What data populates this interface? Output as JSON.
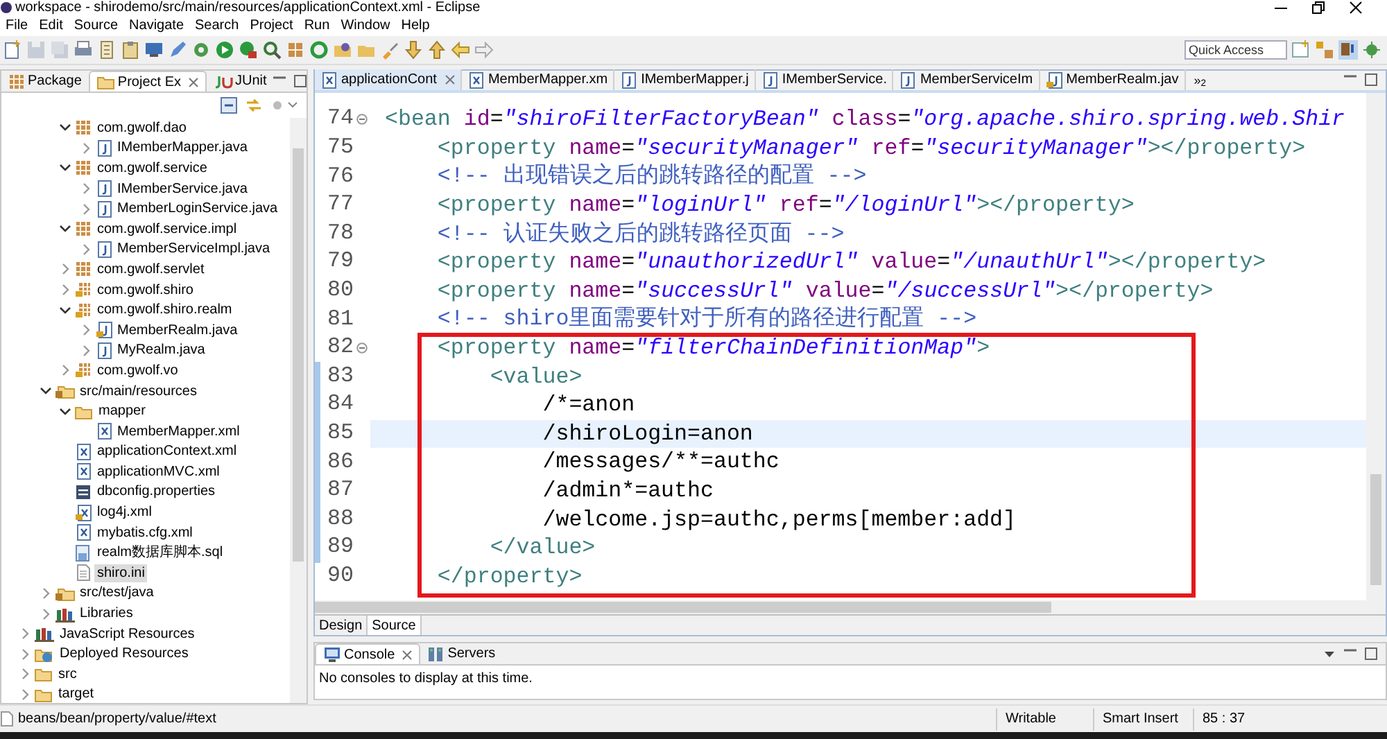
{
  "window": {
    "title": "workspace - shirodemo/src/main/resources/applicationContext.xml - Eclipse"
  },
  "menu": [
    "File",
    "Edit",
    "Source",
    "Navigate",
    "Search",
    "Project",
    "Run",
    "Window",
    "Help"
  ],
  "toolbar": {
    "quick_access": {
      "placeholder": "Quick Access"
    }
  },
  "left_view": {
    "tabs": [
      {
        "label": "Package",
        "kind": "package",
        "selected": false,
        "closable": false
      },
      {
        "label": "Project Ex",
        "kind": "folder",
        "selected": true,
        "closable": true
      },
      {
        "label": "JUnit",
        "kind": "junit",
        "selected": false,
        "closable": false
      }
    ],
    "tree": [
      {
        "children": [
          {
            "children": [
              {
                "label": "com.gwolf.dao",
                "kind": "package",
                "expanded": true,
                "selected": false,
                "children": [
                  {
                    "label": "IMemberMapper.java",
                    "kind": "java",
                    "expanded": false,
                    "selected": false
                  }
                ]
              },
              {
                "label": "com.gwolf.service",
                "kind": "package",
                "expanded": true,
                "selected": false,
                "children": [
                  {
                    "label": "IMemberService.java",
                    "kind": "java",
                    "expanded": false,
                    "selected": false
                  },
                  {
                    "label": "MemberLoginService.java",
                    "kind": "java",
                    "expanded": false,
                    "selected": false
                  }
                ]
              },
              {
                "label": "com.gwolf.service.impl",
                "kind": "package",
                "expanded": true,
                "selected": false,
                "children": [
                  {
                    "label": "MemberServiceImpl.java",
                    "kind": "java",
                    "expanded": false,
                    "selected": false
                  }
                ]
              },
              {
                "label": "com.gwolf.servlet",
                "kind": "package",
                "expanded": false,
                "selected": false
              },
              {
                "label": "com.gwolf.shiro",
                "kind": "package-locked",
                "expanded": false,
                "selected": false
              },
              {
                "label": "com.gwolf.shiro.realm",
                "kind": "package-locked",
                "expanded": true,
                "selected": false,
                "children": [
                  {
                    "label": "MemberRealm.java",
                    "kind": "java-locked",
                    "expanded": false,
                    "selected": false
                  },
                  {
                    "label": "MyRealm.java",
                    "kind": "java",
                    "expanded": false,
                    "selected": false
                  }
                ]
              },
              {
                "label": "com.gwolf.vo",
                "kind": "package-locked",
                "expanded": false,
                "selected": false
              }
            ]
          },
          {
            "label": "src/main/resources",
            "kind": "source-folder",
            "expanded": true,
            "selected": false,
            "children": [
              {
                "label": "mapper",
                "kind": "folder",
                "expanded": true,
                "selected": false,
                "children": [
                  {
                    "label": "MemberMapper.xml",
                    "kind": "xml",
                    "selected": false
                  }
                ]
              },
              {
                "label": "applicationContext.xml",
                "kind": "xml",
                "selected": false
              },
              {
                "label": "applicationMVC.xml",
                "kind": "xml",
                "selected": false
              },
              {
                "label": "dbconfig.properties",
                "kind": "properties",
                "selected": false
              },
              {
                "label": "log4j.xml",
                "kind": "xml-locked",
                "selected": false
              },
              {
                "label": "mybatis.cfg.xml",
                "kind": "xml",
                "selected": false
              },
              {
                "label": "realm数据库脚本.sql",
                "kind": "sql",
                "selected": false
              },
              {
                "label": "shiro.ini",
                "kind": "file",
                "selected": true
              }
            ]
          },
          {
            "label": "src/test/java",
            "kind": "source-folder",
            "expanded": false,
            "selected": false
          },
          {
            "label": "Libraries",
            "kind": "library",
            "expanded": false,
            "selected": false
          }
        ]
      },
      {
        "label": "JavaScript Resources",
        "kind": "library",
        "expanded": false,
        "selected": false
      },
      {
        "label": "Deployed Resources",
        "kind": "deployed",
        "expanded": false,
        "selected": false
      },
      {
        "label": "src",
        "kind": "folder",
        "expanded": false,
        "selected": false
      },
      {
        "label": "target",
        "kind": "folder",
        "expanded": false,
        "selected": false
      }
    ]
  },
  "editor": {
    "tabs": [
      {
        "label": "applicationCont",
        "kind": "xml",
        "selected": true,
        "closable": true
      },
      {
        "label": "MemberMapper.xm",
        "kind": "xml",
        "selected": false,
        "closable": false
      },
      {
        "label": "IMemberMapper.j",
        "kind": "java",
        "selected": false,
        "closable": false
      },
      {
        "label": "IMemberService.",
        "kind": "java",
        "selected": false,
        "closable": false
      },
      {
        "label": "MemberServiceIm",
        "kind": "java",
        "selected": false,
        "closable": false
      },
      {
        "label": "MemberRealm.jav",
        "kind": "java-locked",
        "selected": false,
        "closable": false
      }
    ],
    "overflow": "»$_{2}$",
    "lines": [
      {
        "number": "74",
        "foldable": true,
        "current": false,
        "changed": false,
        "tokens": [
          {
            "kind": "tag",
            "text": " <bean "
          },
          {
            "kind": "attr",
            "text": "id"
          },
          {
            "kind": "plain",
            "text": "="
          },
          {
            "kind": "value",
            "text": "\"shiroFilterFactoryBean\""
          },
          {
            "kind": "attr",
            "text": " class"
          },
          {
            "kind": "plain",
            "text": "="
          },
          {
            "kind": "value",
            "text": "\"org.apache.shiro.spring.web.Shir"
          }
        ]
      },
      {
        "number": "75",
        "foldable": false,
        "current": false,
        "changed": false,
        "tokens": [
          {
            "kind": "tag",
            "text": "     <property "
          },
          {
            "kind": "attr",
            "text": "name"
          },
          {
            "kind": "plain",
            "text": "="
          },
          {
            "kind": "value",
            "text": "\"securityManager\""
          },
          {
            "kind": "attr",
            "text": " ref"
          },
          {
            "kind": "plain",
            "text": "="
          },
          {
            "kind": "value",
            "text": "\"securityManager\""
          },
          {
            "kind": "tag",
            "text": "></property>"
          }
        ]
      },
      {
        "number": "76",
        "foldable": false,
        "current": false,
        "changed": false,
        "tokens": [
          {
            "kind": "comment",
            "text": "     <!-- 出现错误之后的跳转路径的配置 -->"
          }
        ]
      },
      {
        "number": "77",
        "foldable": false,
        "current": false,
        "changed": false,
        "tokens": [
          {
            "kind": "tag",
            "text": "     <property "
          },
          {
            "kind": "attr",
            "text": "name"
          },
          {
            "kind": "plain",
            "text": "="
          },
          {
            "kind": "value",
            "text": "\"loginUrl\""
          },
          {
            "kind": "attr",
            "text": " ref"
          },
          {
            "kind": "plain",
            "text": "="
          },
          {
            "kind": "value",
            "text": "\"/loginUrl\""
          },
          {
            "kind": "tag",
            "text": "></property>"
          }
        ]
      },
      {
        "number": "78",
        "foldable": false,
        "current": false,
        "changed": false,
        "tokens": [
          {
            "kind": "comment",
            "text": "     <!-- 认证失败之后的跳转路径页面 -->"
          }
        ]
      },
      {
        "number": "79",
        "foldable": false,
        "current": false,
        "changed": false,
        "tokens": [
          {
            "kind": "tag",
            "text": "     <property "
          },
          {
            "kind": "attr",
            "text": "name"
          },
          {
            "kind": "plain",
            "text": "="
          },
          {
            "kind": "value",
            "text": "\"unauthorizedUrl\""
          },
          {
            "kind": "attr",
            "text": " value"
          },
          {
            "kind": "plain",
            "text": "="
          },
          {
            "kind": "value",
            "text": "\"/unauthUrl\""
          },
          {
            "kind": "tag",
            "text": "></property>"
          }
        ]
      },
      {
        "number": "80",
        "foldable": false,
        "current": false,
        "changed": false,
        "tokens": [
          {
            "kind": "tag",
            "text": "     <property "
          },
          {
            "kind": "attr",
            "text": "name"
          },
          {
            "kind": "plain",
            "text": "="
          },
          {
            "kind": "value",
            "text": "\"successUrl\""
          },
          {
            "kind": "attr",
            "text": " value"
          },
          {
            "kind": "plain",
            "text": "="
          },
          {
            "kind": "value",
            "text": "\"/successUrl\""
          },
          {
            "kind": "tag",
            "text": "></property>"
          }
        ]
      },
      {
        "number": "81",
        "foldable": false,
        "current": false,
        "changed": false,
        "tokens": [
          {
            "kind": "comment",
            "text": "     <!-- shiro里面需要针对于所有的路径进行配置 -->"
          }
        ]
      },
      {
        "number": "82",
        "foldable": true,
        "current": false,
        "changed": false,
        "tokens": [
          {
            "kind": "tag",
            "text": "     <property "
          },
          {
            "kind": "attr",
            "text": "name"
          },
          {
            "kind": "plain",
            "text": "="
          },
          {
            "kind": "value",
            "text": "\"filterChainDefinitionMap\""
          },
          {
            "kind": "tag",
            "text": ">"
          }
        ]
      },
      {
        "number": "83",
        "foldable": false,
        "current": false,
        "changed": true,
        "tokens": [
          {
            "kind": "tag",
            "text": "         <value>"
          }
        ]
      },
      {
        "number": "84",
        "foldable": false,
        "current": false,
        "changed": true,
        "tokens": [
          {
            "kind": "plain",
            "text": "             /*=anon"
          }
        ]
      },
      {
        "number": "85",
        "foldable": false,
        "current": true,
        "changed": true,
        "tokens": [
          {
            "kind": "plain",
            "text": "             /shiroLogin=anon"
          }
        ]
      },
      {
        "number": "86",
        "foldable": false,
        "current": false,
        "changed": true,
        "tokens": [
          {
            "kind": "plain",
            "text": "             /messages/**=authc"
          }
        ]
      },
      {
        "number": "87",
        "foldable": false,
        "current": false,
        "changed": true,
        "tokens": [
          {
            "kind": "plain",
            "text": "             /admin*=authc"
          }
        ]
      },
      {
        "number": "88",
        "foldable": false,
        "current": false,
        "changed": true,
        "tokens": [
          {
            "kind": "plain",
            "text": "             /welcome.jsp=authc,perms[member:add]"
          }
        ]
      },
      {
        "number": "89",
        "foldable": false,
        "current": false,
        "changed": true,
        "tokens": [
          {
            "kind": "tag",
            "text": "         </value>"
          }
        ]
      },
      {
        "number": "90",
        "foldable": false,
        "current": false,
        "changed": false,
        "tokens": [
          {
            "kind": "tag",
            "text": "     </property>"
          }
        ]
      }
    ],
    "annotation": {
      "kind": "rectangle"
    },
    "bottom_tabs": [
      {
        "label": "Design",
        "selected": false
      },
      {
        "label": "Source",
        "selected": true
      }
    ]
  },
  "console": {
    "tabs": [
      {
        "label": "Console",
        "kind": "monitor",
        "selected": true,
        "closable": true
      },
      {
        "label": "Servers",
        "kind": "servers",
        "selected": false,
        "closable": false
      }
    ],
    "message": "No consoles to display at this time."
  },
  "status_bar": {
    "path": "beans/bean/property/value/#text",
    "fields": [
      "Writable",
      "Smart Insert",
      "85 : 37"
    ]
  }
}
